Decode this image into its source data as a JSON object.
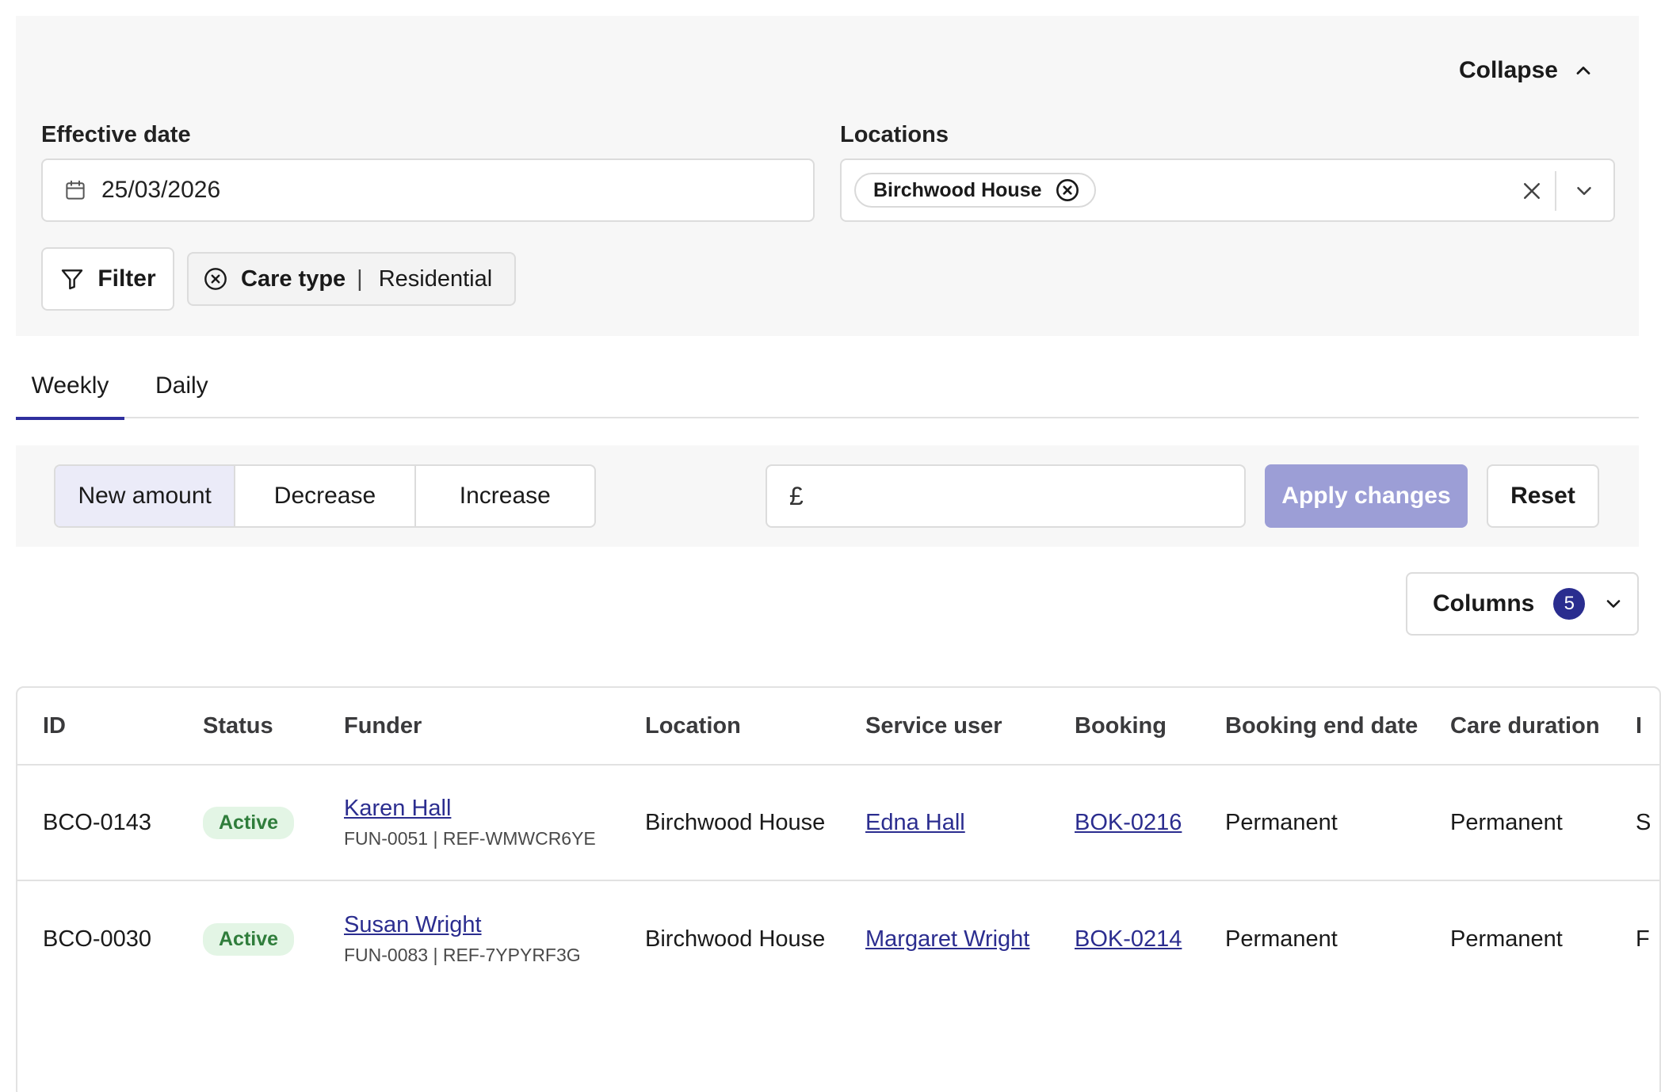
{
  "filters": {
    "collapse_label": "Collapse",
    "effective_date_label": "Effective date",
    "effective_date_value": "25/03/2026",
    "locations_label": "Locations",
    "location_chips": [
      "Birchwood House"
    ],
    "filter_button_label": "Filter",
    "care_type_key": "Care type",
    "care_type_sep": "|",
    "care_type_value": "Residential"
  },
  "tabs": [
    {
      "label": "Weekly",
      "active": true
    },
    {
      "label": "Daily",
      "active": false
    }
  ],
  "adjust": {
    "modes": [
      {
        "label": "New amount",
        "active": true
      },
      {
        "label": "Decrease",
        "active": false
      },
      {
        "label": "Increase",
        "active": false
      }
    ],
    "currency_symbol": "£",
    "amount_value": "",
    "apply_label": "Apply changes",
    "reset_label": "Reset"
  },
  "columns": {
    "label": "Columns",
    "count": "5"
  },
  "table": {
    "headers": [
      "ID",
      "Status",
      "Funder",
      "Location",
      "Service user",
      "Booking",
      "Booking end date",
      "Care duration",
      "I"
    ],
    "rows": [
      {
        "id": "BCO-0143",
        "status": "Active",
        "funder_name": "Karen Hall",
        "funder_ref": "FUN-0051 | REF-WMWCR6YE",
        "location": "Birchwood House",
        "service_user": "Edna Hall",
        "booking": "BOK-0216",
        "booking_end": "Permanent",
        "care_duration": "Permanent",
        "extra": "S"
      },
      {
        "id": "BCO-0030",
        "status": "Active",
        "funder_name": "Susan Wright",
        "funder_ref": "FUN-0083 | REF-7YPYRF3G",
        "location": "Birchwood House",
        "service_user": "Margaret Wright",
        "booking": "BOK-0214",
        "booking_end": "Permanent",
        "care_duration": "Permanent",
        "extra": "F"
      }
    ]
  },
  "colors": {
    "accent": "#2a2d8f",
    "apply_button": "#9c9ed6",
    "active_badge_bg": "#e3f5e5",
    "active_badge_text": "#2f7d3b",
    "panel_bg": "#f7f7f7"
  }
}
